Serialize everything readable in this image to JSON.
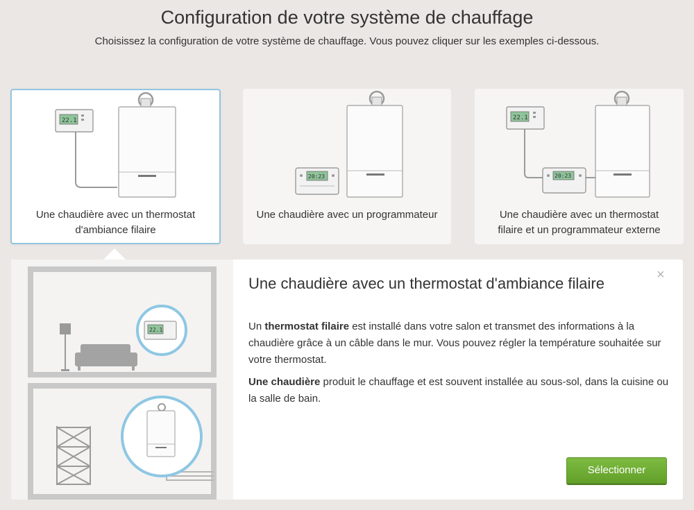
{
  "header": {
    "title": "Configuration de votre système de chauffage",
    "subtitle": "Choisissez la configuration de votre système de chauffage. Vous pouvez cliquer sur les exemples ci-dessous."
  },
  "cards": [
    {
      "line1": "Une chaudière avec un thermostat",
      "line2": "d'ambiance filaire",
      "selected": true,
      "thermostat_display": "22.1"
    },
    {
      "line1": "Une chaudière avec un programmateur",
      "line2": "",
      "selected": false,
      "programmer_display": "20:23"
    },
    {
      "line1": "Une chaudière avec un thermostat",
      "line2": "filaire et un programmateur externe",
      "selected": false,
      "thermostat_display": "22.1",
      "programmer_display": "20:23"
    }
  ],
  "detail": {
    "title": "Une chaudière avec un thermostat d'ambiance filaire",
    "p1_pre": "Un ",
    "p1_bold": "thermostat filaire",
    "p1_post": " est installé dans votre salon et transmet des informations à la chaudière grâce à un câble dans le mur. Vous pouvez régler la température souhaitée sur votre thermostat.",
    "p2_bold": "Une chaudière",
    "p2_post": " produit le chauffage et est souvent installée au sous-sol, dans la cuisine ou la salle de bain.",
    "close_label": "×",
    "select_label": "Sélectionner",
    "illus_thermostat_display": "22.1"
  },
  "colors": {
    "background": "#ebe7e4",
    "selected_border": "#92c5de",
    "select_button": "#6aa832",
    "lcd": "#8fc49a"
  }
}
